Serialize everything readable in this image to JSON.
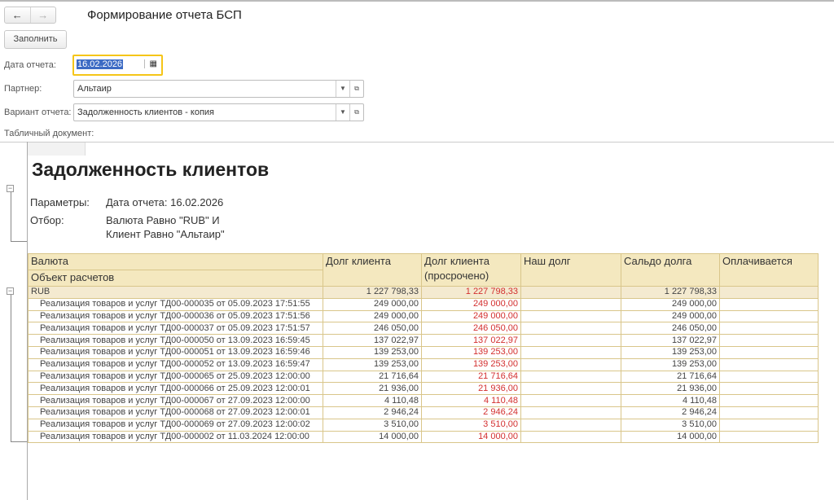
{
  "window": {
    "title": "Формирование отчета БСП",
    "back": "←",
    "forward": "→",
    "fill_button": "Заполнить"
  },
  "form": {
    "date_label": "Дата отчета:",
    "date_value": "16.02.2026",
    "partner_label": "Партнер:",
    "partner_value": "Альтаир",
    "variant_label": "Вариант отчета:",
    "variant_value": "Задолженность клиентов - копия",
    "doc_label": "Табличный документ:"
  },
  "report": {
    "title": "Задолженность клиентов",
    "params_label": "Параметры:",
    "params_value": "Дата отчета: 16.02.2026",
    "filter_label": "Отбор:",
    "filter_line1": "Валюта Равно \"RUB\" И",
    "filter_line2": "Клиент Равно \"Альтаир\"",
    "columns": {
      "currency": "Валюта",
      "object": "Объект расчетов",
      "debt": "Долг клиента",
      "overdue": "Долг клиента",
      "overdue2": "(просрочено)",
      "our_debt": "Наш долг",
      "balance": "Сальдо долга",
      "paying": "Оплачивается"
    },
    "group": {
      "name": "RUB",
      "debt": "1 227 798,33",
      "overdue": "1 227 798,33",
      "balance": "1 227 798,33"
    },
    "rows": [
      {
        "name": "Реализация товаров и услуг ТД00-000035 от 05.09.2023 17:51:55",
        "debt": "249 000,00",
        "overdue": "249 000,00",
        "balance": "249 000,00"
      },
      {
        "name": "Реализация товаров и услуг ТД00-000036 от 05.09.2023 17:51:56",
        "debt": "249 000,00",
        "overdue": "249 000,00",
        "balance": "249 000,00"
      },
      {
        "name": "Реализация товаров и услуг ТД00-000037 от 05.09.2023 17:51:57",
        "debt": "246 050,00",
        "overdue": "246 050,00",
        "balance": "246 050,00"
      },
      {
        "name": "Реализация товаров и услуг ТД00-000050 от 13.09.2023 16:59:45",
        "debt": "137 022,97",
        "overdue": "137 022,97",
        "balance": "137 022,97"
      },
      {
        "name": "Реализация товаров и услуг ТД00-000051 от 13.09.2023 16:59:46",
        "debt": "139 253,00",
        "overdue": "139 253,00",
        "balance": "139 253,00"
      },
      {
        "name": "Реализация товаров и услуг ТД00-000052 от 13.09.2023 16:59:47",
        "debt": "139 253,00",
        "overdue": "139 253,00",
        "balance": "139 253,00"
      },
      {
        "name": "Реализация товаров и услуг ТД00-000065 от 25.09.2023 12:00:00",
        "debt": "21 716,64",
        "overdue": "21 716,64",
        "balance": "21 716,64"
      },
      {
        "name": "Реализация товаров и услуг ТД00-000066 от 25.09.2023 12:00:01",
        "debt": "21 936,00",
        "overdue": "21 936,00",
        "balance": "21 936,00"
      },
      {
        "name": "Реализация товаров и услуг ТД00-000067 от 27.09.2023 12:00:00",
        "debt": "4 110,48",
        "overdue": "4 110,48",
        "balance": "4 110,48"
      },
      {
        "name": "Реализация товаров и услуг ТД00-000068 от 27.09.2023 12:00:01",
        "debt": "2 946,24",
        "overdue": "2 946,24",
        "balance": "2 946,24"
      },
      {
        "name": "Реализация товаров и услуг ТД00-000069 от 27.09.2023 12:00:02",
        "debt": "3 510,00",
        "overdue": "3 510,00",
        "balance": "3 510,00"
      },
      {
        "name": "Реализация товаров и услуг ТД00-000002 от 11.03.2024 12:00:00",
        "debt": "14 000,00",
        "overdue": "14 000,00",
        "balance": "14 000,00"
      }
    ]
  }
}
